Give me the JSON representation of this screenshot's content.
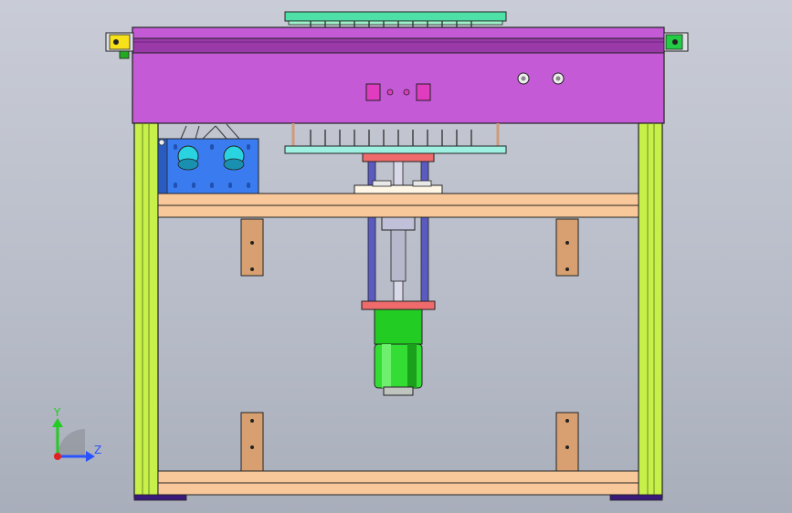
{
  "view": {
    "background_top": "#c9ccd6",
    "background_bottom": "#a9aebb"
  },
  "colors": {
    "frame_post": "#c8f04a",
    "top_housing": "#c45ad6",
    "wood": "#f8c89a",
    "bracket": "#d8a070",
    "comb": "#4fe0a8",
    "motor": "#22cc22",
    "hub": "#29d3e0",
    "panel": "#3a7cf0",
    "flange": "#ef6b6b"
  },
  "triad": {
    "y_label": "Y",
    "z_label": "Z",
    "y_color": "#22cc22",
    "z_color": "#2a52ff",
    "origin_color": "#e02222",
    "arc_color": "#8a8d94"
  },
  "icons": {
    "axis": "axis-triad-icon",
    "tabs": "tab-block-icon"
  }
}
